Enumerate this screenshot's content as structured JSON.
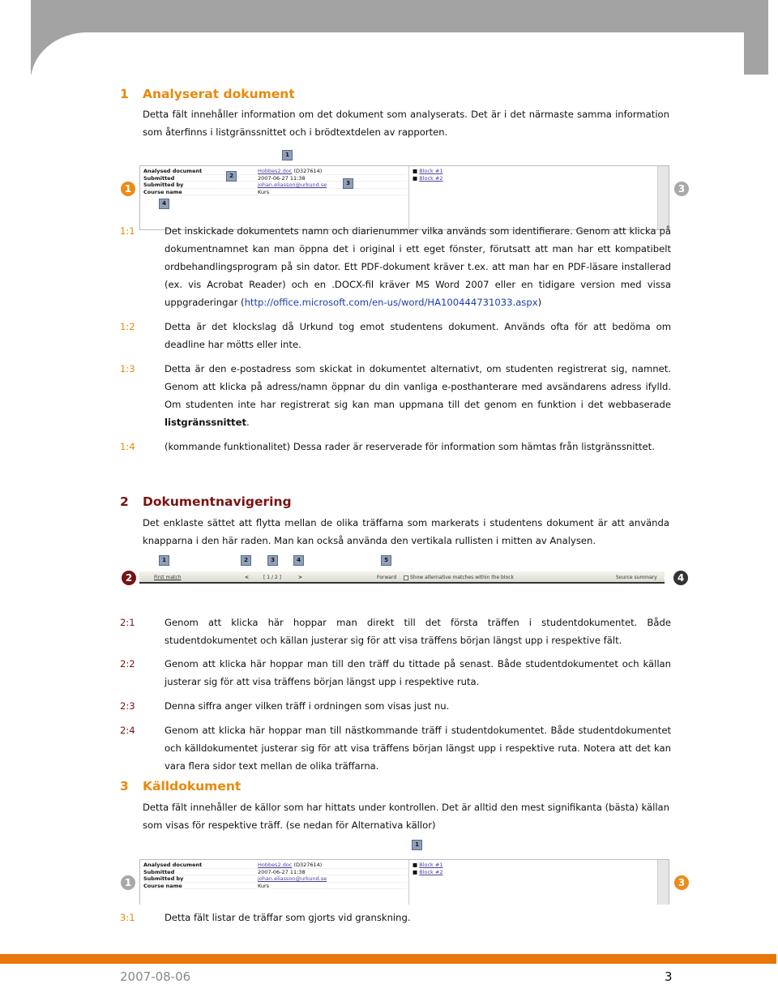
{
  "colors": {
    "accent_orange": "#e8890c",
    "accent_darkred": "#7a1212",
    "footer_bar": "#e8770a"
  },
  "s1": {
    "num": "1",
    "title": "Analyserat dokument",
    "intro": "Detta fält innehåller information om det dokument som analyserats. Det är i det närmaste samma information som återfinns i listgränssnittet och i brödtextdelen av rapporten.",
    "items": [
      {
        "label": "1:1",
        "text": "Det inskickade dokumentets namn och diarienummer vilka används som identifierare. Genom att klicka på dokumentnamnet kan man öppna det i original i ett eget fönster, förutsatt att man har ett kompatibelt ordbehandlingsprogram på sin dator. Ett PDF-dokument kräver t.ex. att man har en PDF-läsare installerad (ex. vis Acrobat Reader) och en .DOCX-fil kräver MS Word 2007 eller en tidigare version med vissa uppgraderingar (",
        "link": "http://office.microsoft.com/en-us/word/HA100444731033.aspx",
        "after": ")"
      },
      {
        "label": "1:2",
        "text": "Detta är det klockslag då Urkund tog emot studentens dokument. Används ofta för att bedöma om deadline har mötts eller inte."
      },
      {
        "label": "1:3",
        "text": "Detta är den e-postadress som skickat in dokumentet alternativt, om studenten registrerat sig, namnet. Genom att klicka på adress/namn öppnar du din vanliga e-posthanterare med avsändarens adress ifylld. Om studenten inte har registrerat sig kan man uppmana till det genom en funktion i det webbaserade ",
        "bold": "listgränssnittet",
        "after": "."
      },
      {
        "label": "1:4",
        "text": "(kommande funktionalitet) Dessa rader är reserverade för information som hämtas från listgränssnittet."
      }
    ]
  },
  "doc_panel": {
    "rows": [
      {
        "key": "Analysed document",
        "link": "Hobbes2.doc",
        "value": " (D327614)"
      },
      {
        "key": "Submitted",
        "value": "2007-06-27 11:38"
      },
      {
        "key": "Submitted by",
        "link": "johan.eliasson@urkund.se"
      },
      {
        "key": "Course name",
        "value": "Kurs"
      }
    ],
    "blocks": [
      "Block #1",
      "Block #2"
    ],
    "bullet": "■"
  },
  "callouts": {
    "c1": "1",
    "c2": "2",
    "c3": "3",
    "c4": "4",
    "c5": "5"
  },
  "s2": {
    "num": "2",
    "title": "Dokumentnavigering",
    "intro": "Det enklaste sättet att flytta mellan de olika träffarna som markerats i studentens dokument är att använda knapparna i den här raden. Man kan också använda den vertikala rullisten i mitten av Analysen.",
    "nav": {
      "first": "First match",
      "prev": "<",
      "counter": "[ 1 / 2 ]",
      "next": ">",
      "forward": "Forward",
      "alt": "Show alternative matches within the block",
      "summary": "Source summary"
    },
    "items": [
      {
        "label": "2:1",
        "text": "Genom att klicka här hoppar man direkt till det första träffen i studentdokumentet. Både studentdokumentet och källan justerar sig för att visa träffens början längst upp i respektive fält."
      },
      {
        "label": "2:2",
        "text": "Genom att klicka här hoppar man till den träff du tittade på senast. Både studentdokumentet och källan justerar sig för att visa träffens början längst upp i respektive ruta."
      },
      {
        "label": "2:3",
        "text": "Denna siffra anger vilken träff i ordningen som visas just nu."
      },
      {
        "label": "2:4",
        "text": "Genom att klicka här hoppar man till nästkommande träff i studentdokumentet. Både studentdokumentet och källdokumentet justerar sig för att visa träffens början längst upp i respektive ruta. Notera att det kan vara flera sidor text mellan de olika träffarna."
      }
    ]
  },
  "s3": {
    "num": "3",
    "title": "Källdokument",
    "intro": "Detta fält innehåller de källor som har hittats under kontrollen. Det är alltid den mest signifikanta (bästa) källan som visas för respektive träff. (se nedan för Alternativa källor)",
    "items": [
      {
        "label": "3:1",
        "text": "Detta fält listar de träffar som gjorts vid granskning."
      }
    ]
  },
  "footer": {
    "date": "2007-08-06",
    "page": "3"
  }
}
